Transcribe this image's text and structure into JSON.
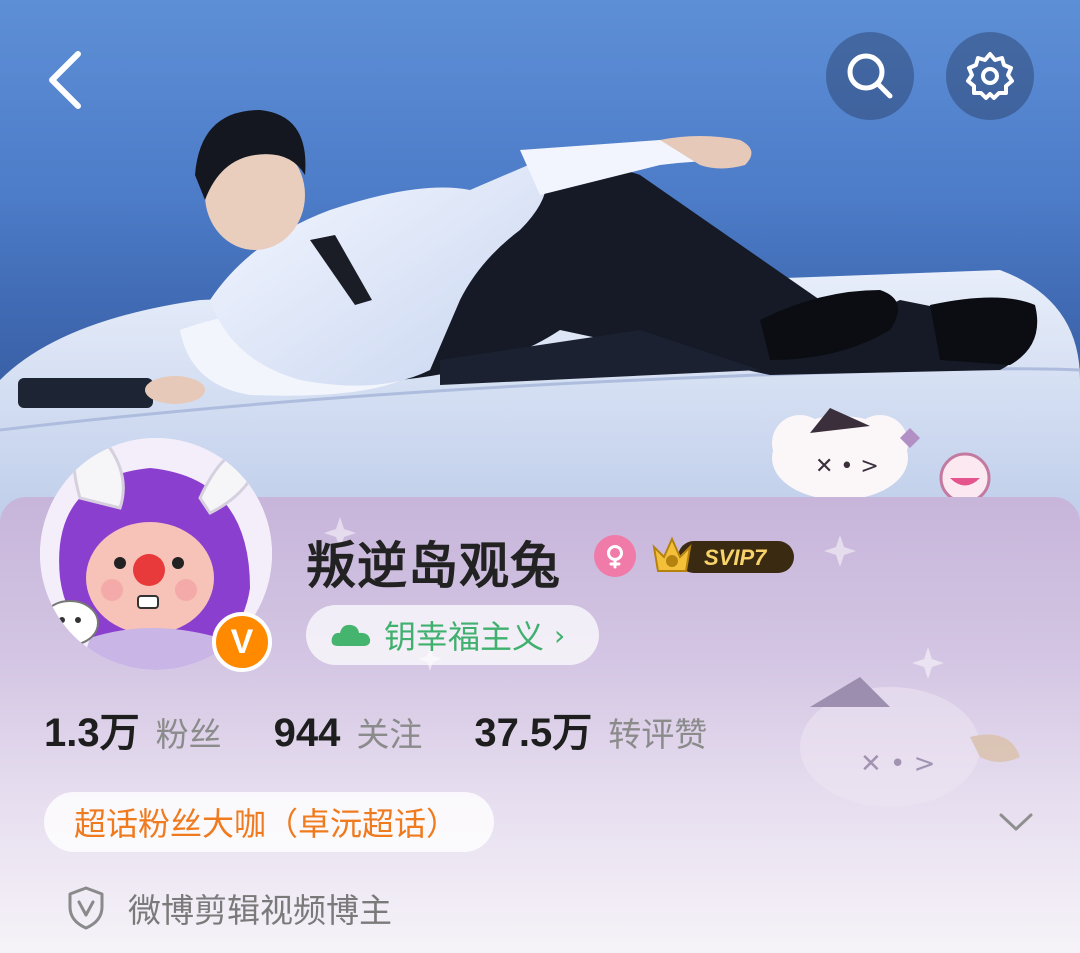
{
  "header": {
    "back_icon": "chevron-left-icon",
    "search_icon": "search-icon",
    "settings_icon": "gear-icon"
  },
  "profile": {
    "username": "叛逆岛观兔",
    "gender": "female",
    "vip_badge": "SVIP7",
    "verified_badge": "V",
    "tag": "钥幸福主义",
    "tag_chevron": "›"
  },
  "stats": [
    {
      "value": "1.3万",
      "label": "粉丝"
    },
    {
      "value": "944",
      "label": "关注"
    },
    {
      "value": "37.5万",
      "label": "转评赞"
    }
  ],
  "chaohua_badge": "超话粉丝大咖（卓沅超话）",
  "verification": "微博剪辑视频博主",
  "colors": {
    "accent_green": "#3fb06e",
    "accent_orange": "#f07a1e",
    "verified_orange": "#ff8a00",
    "gender_pink": "#f07aa8"
  }
}
